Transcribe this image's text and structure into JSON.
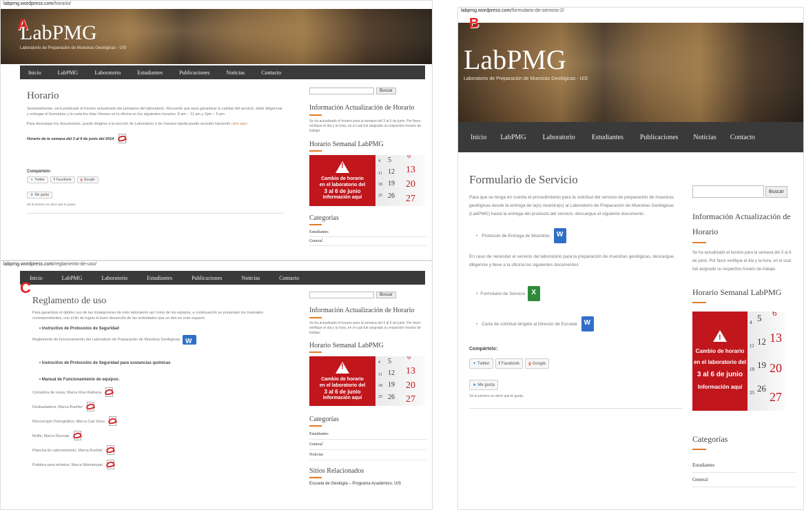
{
  "labels": {
    "a": "A",
    "b": "B",
    "c": "C"
  },
  "colors": {
    "accent": "#e07a25",
    "nav_bg": "#3a3a3a",
    "poster_red": "#c0161c"
  },
  "site": {
    "title": "LabPMG",
    "description": "Laboratorio de Preparación de Muestras Geológicas - UIS",
    "nav": [
      "Inicio",
      "LabPMG",
      "Laboratorio",
      "Estudiantes",
      "Publicaciones",
      "Noticias",
      "Contacto"
    ]
  },
  "panel_a": {
    "url_host": "labpmg.wordpress.com",
    "url_path": "/horario/",
    "page_title": "Horario",
    "para1": "Semanalmente, será publicado el horario actualizado del préstamo del laboratorio. Recuerde que para garantizar la calidad del servicio, debe diligenciar y entregar el formulario y la carta los días Viernes en la oficina en los siguientes horarios: 8 am – 11 am y 2pm – 5 pm",
    "para2_text": "Para descargar los documentos, puede dirigirse a la sección de Laboratorio ó de manera rápida puede acceder haciendo",
    "para2_link": "click aquí",
    "schedule_label": "Horario de la semana del 3 al 6 de junio  del 2014",
    "share_title": "Compártelo:",
    "share_buttons": [
      "Twitter",
      "Facebook",
      "Google"
    ],
    "like_label": "Me gusta",
    "like_text": "Sé el primero en decir que te gusta.",
    "search_button": "Buscar",
    "widget1_title": "Información Actualización de Horario",
    "widget1_text": "Se ha actualizado el horario para la semana del 3 al 6 de junio. Por favor verifique el día y la hora, en el cual fué asignado su respectivo horario de trabajo.",
    "widget2_title": "Horario Semanal LabPMG",
    "widget3_title": "Categorías",
    "categories": [
      "Estudiantes",
      "General"
    ]
  },
  "poster": {
    "line1": "Cambio de horario",
    "line2": "en el laboratorio del",
    "line3": "3 al 6 de junio",
    "line4": "Información aquí",
    "cal_small": [
      "4",
      "11",
      "18",
      "25"
    ],
    "cal_mid": [
      "5",
      "12",
      "19",
      "26"
    ],
    "cal_big": [
      "6",
      "13",
      "20",
      "27"
    ]
  },
  "panel_b": {
    "url_host": "labpmg.wordpress.com",
    "url_path": "/formulario-de-servicio-2/",
    "page_title": "Formulario de Servicio",
    "para1": "Para que se tenga en cuenta el procedimiento para la solicitud del servicio de preparación de muestras geológicas desde la entrega de la(s) muestra(s) al Laboratorio de Preparación de Muestras Geológicas (LabPMG) hasta la entrega del producto del servicio, descargue el siguiente documento:",
    "doc1": "Protocolo de Entrega de Muestras",
    "para2": "En caso de necesitar el servicio del laboratorio para la preparación de muestras geológicas, descargue, diligencie y lleve a la oficina los siguientes documentos:",
    "doc2": "Formulario de Servicio",
    "doc3": "Carta de solicitud dirigida al Director de Escuela",
    "share_title": "Compártelo:",
    "share_buttons": [
      "Twitter",
      "Facebook",
      "Google"
    ],
    "like_label": "Me gusta",
    "like_text": "Sé el primero en decir que te gusta.",
    "search_button": "Buscar",
    "widget1_title": "Información Actualización de Horario",
    "widget1_text": "Se ha actualizado el horario para la semana del 3 al 6 de junio. Por favor verifique el día y la hora, en el cual fué asignado su respectivo horario de trabajo.",
    "widget2_title": "Horario Semanal LabPMG",
    "widget3_title": "Categorías",
    "categories": [
      "Estudiantes",
      "General"
    ]
  },
  "panel_c": {
    "url_host": "labpmg.wordpress.com",
    "url_path": "/reglamento-de-uso/",
    "page_title": "Reglamento de uso",
    "intro": "Para garantizar el óptimo uso de las instalaciones de este laboratorio así como de los equipos, a continuación se presentan los manuales correspondientes, con el fin de lograr el buen desarrollo de las actividades que se den en este espacio.",
    "section1": "Instructivo de Protocolos de Seguridad",
    "section1_doc": "Reglamento de funcionamiento del Laboratorio de Preparación de Muestras Geológicas",
    "section2": "Instructivo de Protocolos de Seguridad para sustancias químicas",
    "section3": "Manual de Funcionamiento de equipos:",
    "equipment": [
      "Cortadora de rocas, Marca Row   Rathena",
      "Desbastadora, Marca Buehler",
      "Microscopio Petrográfico, Marca Carl Zeiss",
      "Mufla, Marca Dizonap",
      "Plancha de calentamiento, Marca Buehler",
      "Pulidora para alúmina, Marca Montasupal"
    ],
    "search_button": "Buscar",
    "widget1_title": "Información Actualización de Horario",
    "widget1_text": "Se ha actualizado el horario para la semana del 3 al 6 de junio. Por favor verifique el día y la hora, en el cual fué asignado su respectivo horario de trabajo.",
    "widget2_title": "Horario Semanal LabPMG",
    "widget3_title": "Categorías",
    "categories": [
      "Estudiantes",
      "General",
      "Noticias"
    ],
    "widget4_title": "Sitios Relacionados",
    "related": "Escuela de Geología – Programa Académico, UIS"
  }
}
